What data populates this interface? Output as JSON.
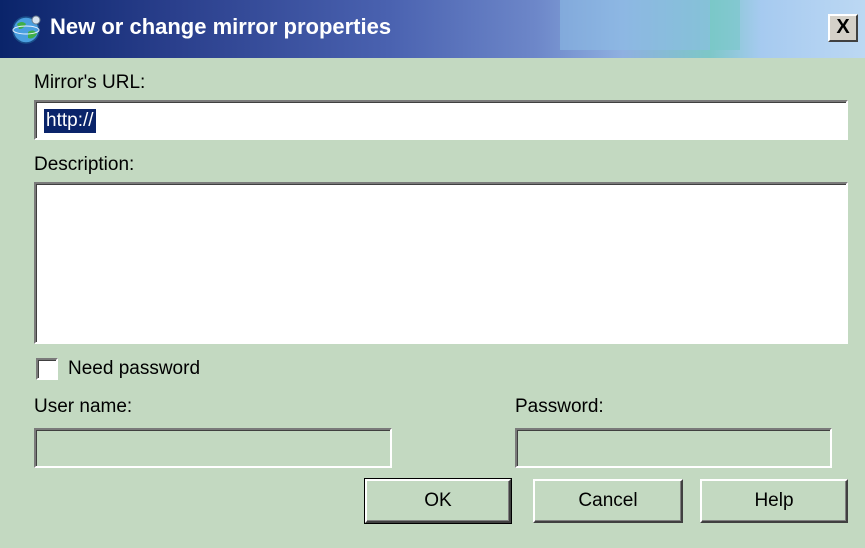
{
  "window": {
    "title": "New or change mirror properties",
    "close_label": "X",
    "icon": "globe-icon"
  },
  "form": {
    "url_label": "Mirror's URL:",
    "url_value": "http://",
    "description_label": "Description:",
    "description_value": "",
    "need_password_label": "Need password",
    "need_password_checked": false,
    "username_label": "User name:",
    "username_value": "",
    "password_label": "Password:",
    "password_value": ""
  },
  "buttons": {
    "ok": "OK",
    "cancel": "Cancel",
    "help": "Help"
  },
  "colors": {
    "dialog_background": "#c3d9c1",
    "title_bar_start": "#0a246a",
    "selection": "#0a246a"
  }
}
